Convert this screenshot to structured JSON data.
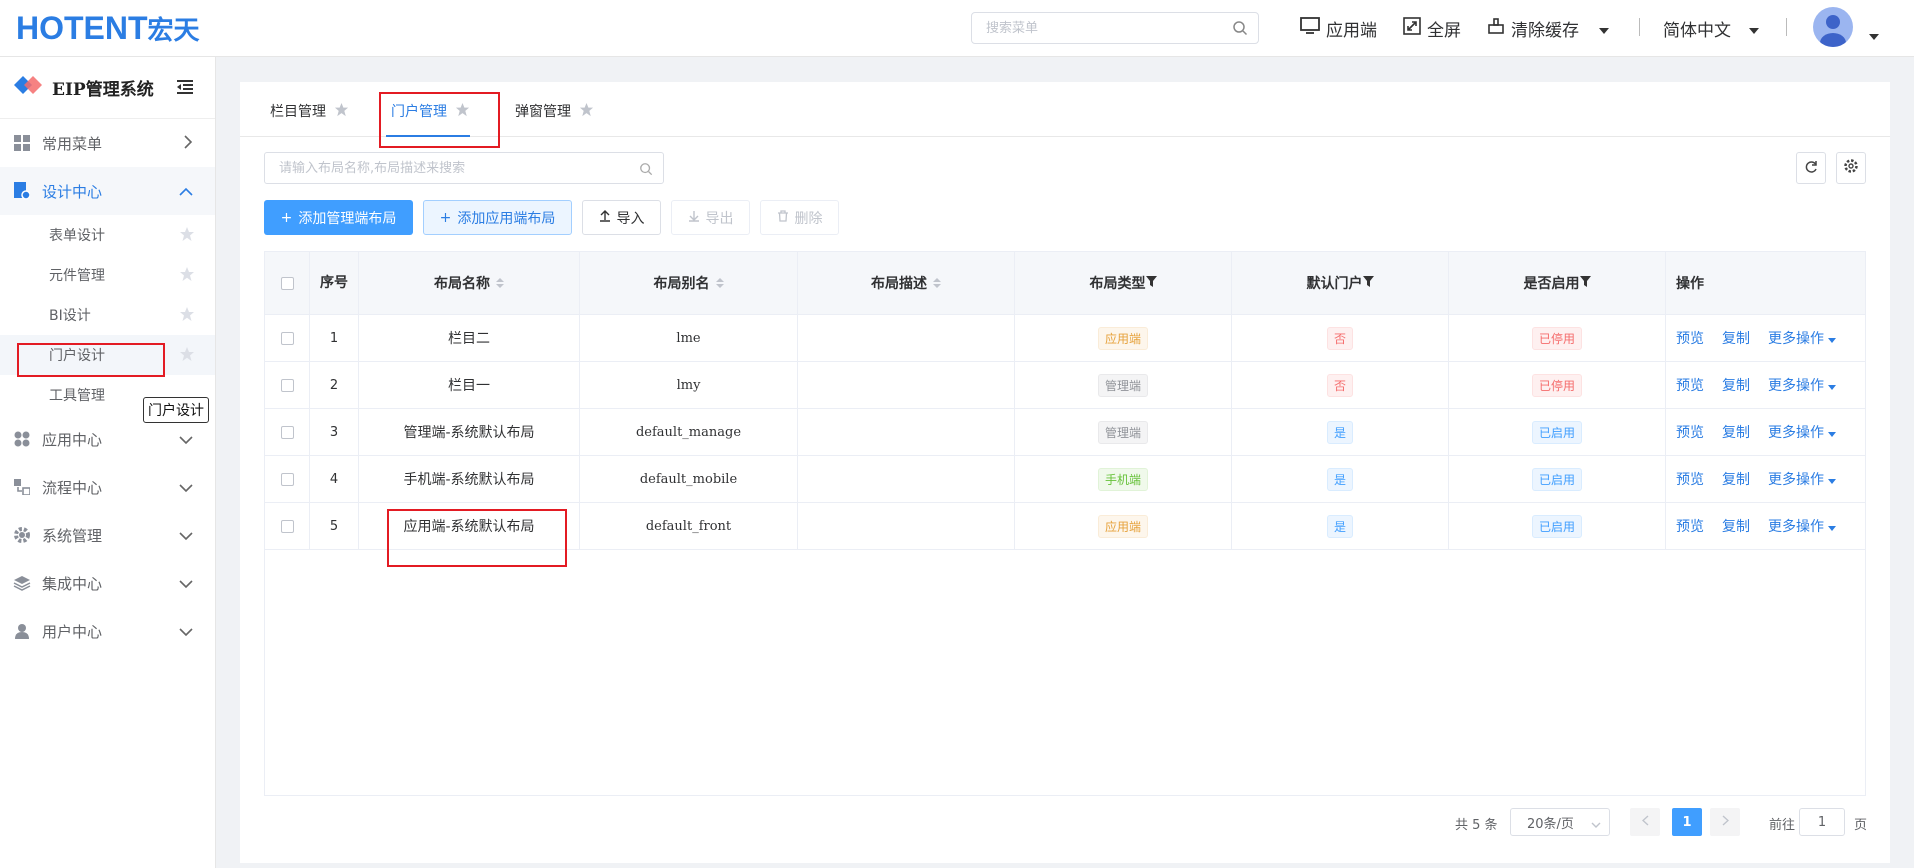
{
  "brand": {
    "logo_text": "HOTENT",
    "logo_cn": "宏天",
    "accent": "#2b7de3"
  },
  "topbar": {
    "search_placeholder": "搜索菜单",
    "app_side": "应用端",
    "fullscreen": "全屏",
    "clear_cache": "清除缓存",
    "language": "简体中文"
  },
  "sidebar": {
    "system_name": "EIP管理系统",
    "menu": [
      {
        "label": "常用菜单"
      },
      {
        "label": "设计中心"
      },
      {
        "label": "应用中心"
      },
      {
        "label": "流程中心"
      },
      {
        "label": "系统管理"
      },
      {
        "label": "集成中心"
      },
      {
        "label": "用户中心"
      }
    ],
    "sub": [
      {
        "label": "表单设计"
      },
      {
        "label": "元件管理"
      },
      {
        "label": "BI设计"
      },
      {
        "label": "门户设计"
      },
      {
        "label": "工具管理"
      }
    ],
    "tooltip": "门户设计"
  },
  "tabs": [
    {
      "label": "栏目管理"
    },
    {
      "label": "门户管理"
    },
    {
      "label": "弹窗管理"
    }
  ],
  "filter": {
    "placeholder": "请输入布局名称,布局描述来搜索"
  },
  "toolbar": {
    "add_manage": "添加管理端布局",
    "add_app": "添加应用端布局",
    "import": "导入",
    "export": "导出",
    "delete": "删除"
  },
  "table": {
    "headers": {
      "index": "序号",
      "name": "布局名称",
      "alias": "布局别名",
      "desc": "布局描述",
      "type": "布局类型",
      "default": "默认门户",
      "enabled": "是否启用",
      "ops": "操作"
    },
    "rows": [
      {
        "idx": "1",
        "name": "栏目二",
        "alias": "lme",
        "desc": "",
        "type": "应用端",
        "type_color": "orange",
        "def": "否",
        "def_color": "red",
        "en": "已停用",
        "en_color": "red"
      },
      {
        "idx": "2",
        "name": "栏目一",
        "alias": "lmy",
        "desc": "",
        "type": "管理端",
        "type_color": "gray",
        "def": "否",
        "def_color": "red",
        "en": "已停用",
        "en_color": "red"
      },
      {
        "idx": "3",
        "name": "管理端-系统默认布局",
        "alias": "default_manage",
        "desc": "",
        "type": "管理端",
        "type_color": "gray",
        "def": "是",
        "def_color": "blue",
        "en": "已启用",
        "en_color": "blue"
      },
      {
        "idx": "4",
        "name": "手机端-系统默认布局",
        "alias": "default_mobile",
        "desc": "",
        "type": "手机端",
        "type_color": "green",
        "def": "是",
        "def_color": "blue",
        "en": "已启用",
        "en_color": "blue"
      },
      {
        "idx": "5",
        "name": "应用端-系统默认布局",
        "alias": "default_front",
        "desc": "",
        "type": "应用端",
        "type_color": "orange",
        "def": "是",
        "def_color": "blue",
        "en": "已启用",
        "en_color": "blue"
      }
    ],
    "op_preview": "预览",
    "op_copy": "复制",
    "op_more": "更多操作"
  },
  "pagination": {
    "total": "共 5 条",
    "page_size": "20条/页",
    "current": "1",
    "goto_label": "前往",
    "goto_value": "1",
    "page_unit": "页"
  }
}
